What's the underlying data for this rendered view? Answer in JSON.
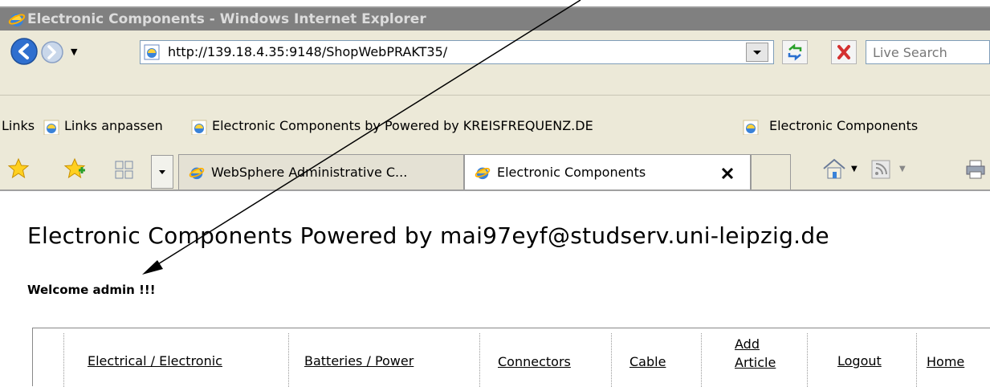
{
  "window": {
    "title": "Electronic Components - Windows Internet Explorer"
  },
  "address_bar": {
    "url": "http://139.18.4.35:9148/ShopWebPRAKT35/",
    "search_placeholder": "Live Search"
  },
  "links_bar": {
    "label": "Links",
    "items": [
      {
        "label": "Links anpassen"
      },
      {
        "label": "Electronic Components by Powered by KREISFREQUENZ.DE"
      },
      {
        "label": "Electronic Components"
      }
    ]
  },
  "tabs": [
    {
      "label": "WebSphere Administrative C..."
    },
    {
      "label": "Electronic Components",
      "active": true
    }
  ],
  "page": {
    "heading": "Electronic Components Powered by mai97eyf@studserv.uni-leipzig.de",
    "welcome": "Welcome admin !!!",
    "nav": [
      {
        "label": "Electrical / Electronic"
      },
      {
        "label": "Batteries / Power"
      },
      {
        "label": "Connectors"
      },
      {
        "label": "Cable"
      },
      {
        "label_line1": "Add",
        "label_line2": "Article"
      },
      {
        "label": "Logout"
      },
      {
        "label": "Home"
      }
    ]
  },
  "colors": {
    "titlebar_bg": "#808080",
    "chrome_bg": "#ece9d8",
    "ie_blue": "#1e5fb4"
  },
  "icons": [
    "ie-logo-icon",
    "back-arrow-icon",
    "forward-arrow-icon",
    "page-icon",
    "refresh-icon",
    "stop-icon",
    "favorites-star-icon",
    "add-favorite-icon",
    "quick-tabs-icon",
    "home-icon",
    "feeds-icon",
    "print-icon",
    "tab-close-icon"
  ]
}
